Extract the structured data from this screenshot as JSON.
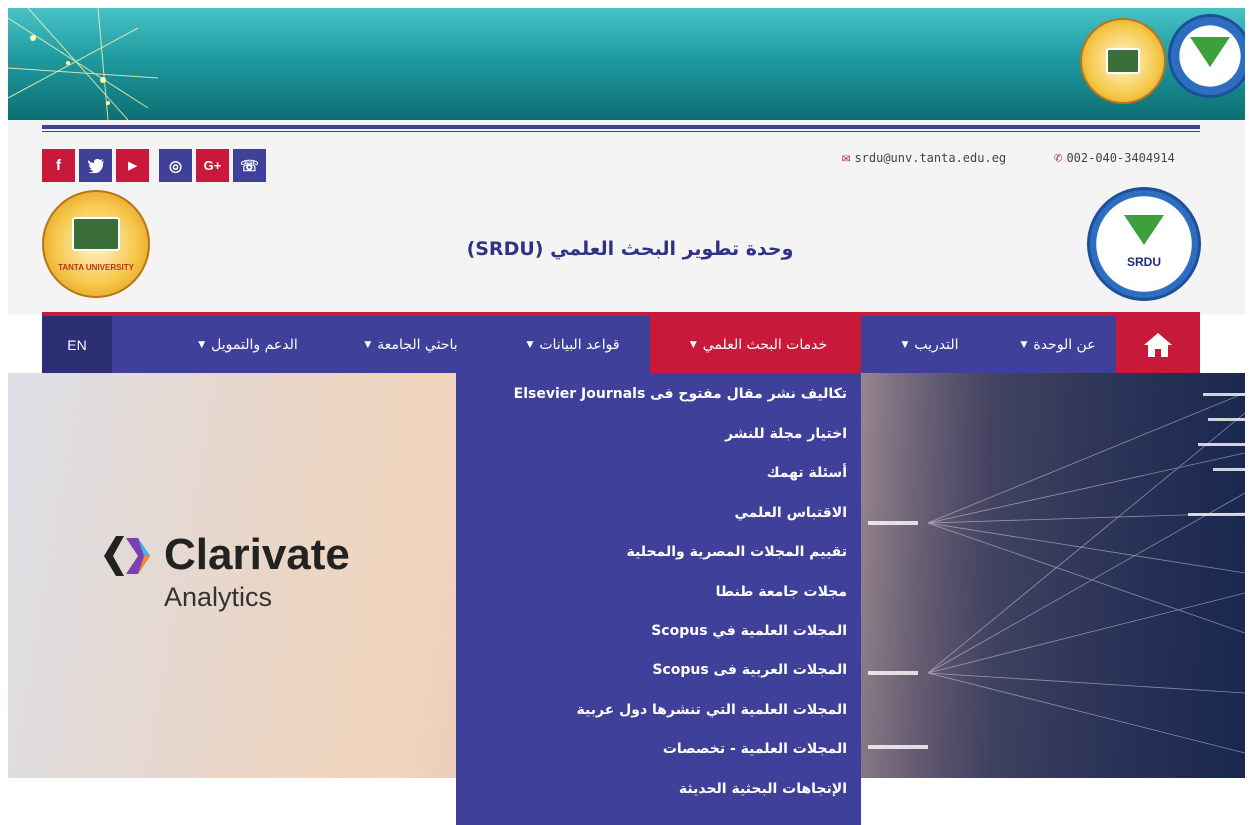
{
  "contact": {
    "email": "srdu@unv.tanta.edu.eg",
    "phone": "002-040-3404914"
  },
  "social": [
    "f",
    "t",
    "▶",
    "◎",
    "G+",
    "☏"
  ],
  "site_title": "وحدة تطوير البحث العلمي (SRDU)",
  "seals": {
    "srdu_label": "SRDU",
    "tanta_label": "TANTA UNIVERSITY"
  },
  "nav": {
    "home_icon": "home-icon",
    "items": [
      {
        "label": "عن الوحدة"
      },
      {
        "label": "التدريب"
      },
      {
        "label": "خدمات البحث العلمي"
      },
      {
        "label": "قواعد البيانات"
      },
      {
        "label": "باحثي الجامعة"
      },
      {
        "label": "الدعم والتمويل"
      }
    ],
    "lang": "EN"
  },
  "hero": {
    "brand": "Clarivate",
    "brand_sub": "Analytics"
  },
  "dropdown": [
    "تكاليف نشر مقال مفتوح فى Elsevier Journals",
    "اختيار مجلة للنشر",
    "أسئلة تهمك",
    "الاقتباس العلمي",
    "تقييم المجلات المصرية والمحلية",
    "مجلات جامعة طنطا",
    "المجلات العلمية في Scopus",
    "المجلات العربية فى Scopus",
    "المجلات العلمية التي تنشرها دول عربية",
    "المجلات العلمية - تخصصات",
    "الإتجاهات البحثية الحديثة"
  ],
  "colors": {
    "brand_blue": "#3f4099",
    "brand_red": "#c8193a",
    "banner_teal": "#1f9aa0"
  }
}
